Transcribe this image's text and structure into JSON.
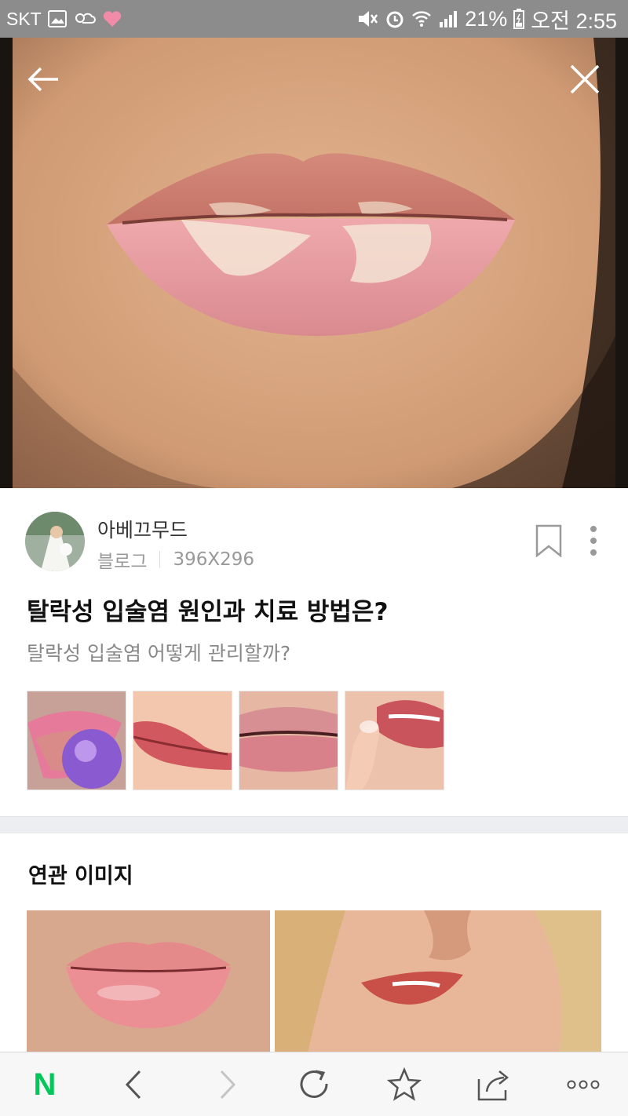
{
  "status_bar": {
    "carrier": "SKT",
    "battery": "21%",
    "time": "오전 2:55"
  },
  "hero": {
    "back_label": "back",
    "close_label": "close"
  },
  "result": {
    "source_name": "아베끄무드",
    "source_type": "블로그",
    "image_size": "396X296",
    "title": "탈락성 입술염 원인과 치료 방법은?",
    "description": "탈락성 입술염 어떻게 관리할까?"
  },
  "related": {
    "title": "연관 이미지"
  },
  "bottom_bar": {
    "logo": "N"
  },
  "colors": {
    "status_bar_bg": "#8c8c8c",
    "naver_green": "#03c75a",
    "divider": "#eceef1"
  },
  "icons": [
    "back-arrow-icon",
    "close-icon",
    "bookmark-icon",
    "more-vertical-icon",
    "chevron-left-icon",
    "chevron-right-icon",
    "refresh-icon",
    "star-icon",
    "share-icon",
    "more-horizontal-icon"
  ]
}
